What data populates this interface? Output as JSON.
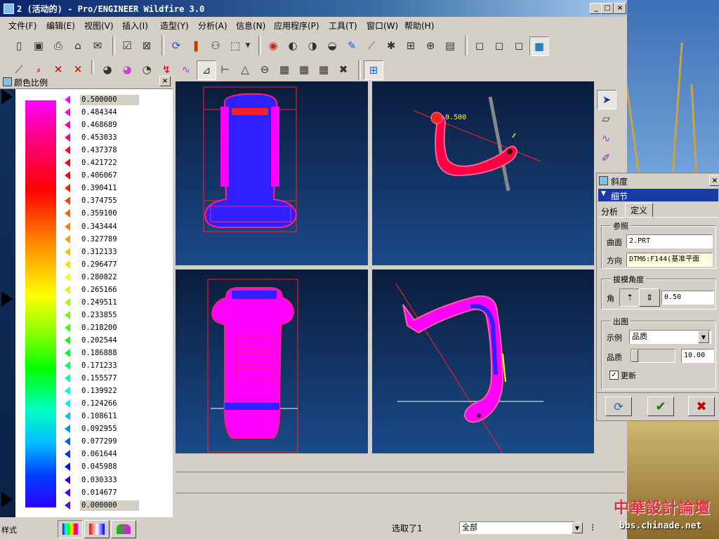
{
  "window": {
    "title": "2 (活动的) - Pro/ENGINEER Wildfire 3.0",
    "minimize": "_",
    "maximize": "□",
    "close": "×"
  },
  "menu": [
    {
      "label": "文件(F)"
    },
    {
      "label": "编辑(E)"
    },
    {
      "label": "视图(V)"
    },
    {
      "label": "插入(I)"
    },
    {
      "label": "造型(Y)"
    },
    {
      "label": "分析(A)"
    },
    {
      "label": "信息(N)"
    },
    {
      "label": "应用程序(P)"
    },
    {
      "label": "工具(T)"
    },
    {
      "label": "窗口(W)"
    },
    {
      "label": "帮助(H)"
    }
  ],
  "color_panel": {
    "title": "颜色比例",
    "values": [
      "0.500000",
      "0.484344",
      "0.468689",
      "0.453033",
      "0.437378",
      "0.421722",
      "0.406067",
      "0.390411",
      "0.374755",
      "0.359100",
      "0.343444",
      "0.327789",
      "0.312133",
      "0.296477",
      "0.280822",
      "0.265166",
      "0.249511",
      "0.233855",
      "0.218200",
      "0.202544",
      "0.186888",
      "0.171233",
      "0.155577",
      "0.139922",
      "0.124266",
      "0.108611",
      "0.092955",
      "0.077299",
      "0.061644",
      "0.045988",
      "0.030333",
      "0.014677",
      "0.000000"
    ],
    "marker_colors": [
      "#ff00ff",
      "#ff00d0",
      "#ff00a0",
      "#ff0070",
      "#ff0040",
      "#ff0010",
      "#ff0000",
      "#ff2000",
      "#ff4000",
      "#ff6000",
      "#ff8000",
      "#ffa000",
      "#ffc000",
      "#ffe000",
      "#ffff00",
      "#d0ff00",
      "#a0ff00",
      "#70ff00",
      "#40ff00",
      "#10ff00",
      "#00ff20",
      "#00ff60",
      "#00ffa0",
      "#00ffd0",
      "#00f0ff",
      "#00c0ff",
      "#0090ff",
      "#0060ff",
      "#0030ff",
      "#1000ff",
      "#3000ff",
      "#4800ff",
      "#6000ff"
    ],
    "style_label": "样式"
  },
  "viewport": {
    "annotation": "0.500"
  },
  "slope_dialog": {
    "title": "斜度",
    "section": "细节",
    "tabs": [
      {
        "label": "分析"
      },
      {
        "label": "定义"
      }
    ],
    "reference": {
      "group": "参照",
      "surface_label": "曲面",
      "surface_value": "2.PRT",
      "direction_label": "方向",
      "direction_value": "DTM6:F144(基准平面"
    },
    "draft": {
      "group": "拔模角度",
      "angle_label": "角",
      "angle_value": "0.50"
    },
    "output": {
      "group": "出图",
      "display_label": "示例",
      "display_value": "品质",
      "quality_label": "品质",
      "quality_value": "10.00",
      "quality_level": 0.0,
      "update_label": "更新",
      "update_checked": true
    },
    "accept_color": "#008000",
    "cancel_color": "#c00000"
  },
  "status": {
    "selected": "选取了1",
    "filter_value": "全部"
  },
  "watermark": {
    "line1": "中華設計論壇",
    "line2": "bbs.chinade.net"
  }
}
